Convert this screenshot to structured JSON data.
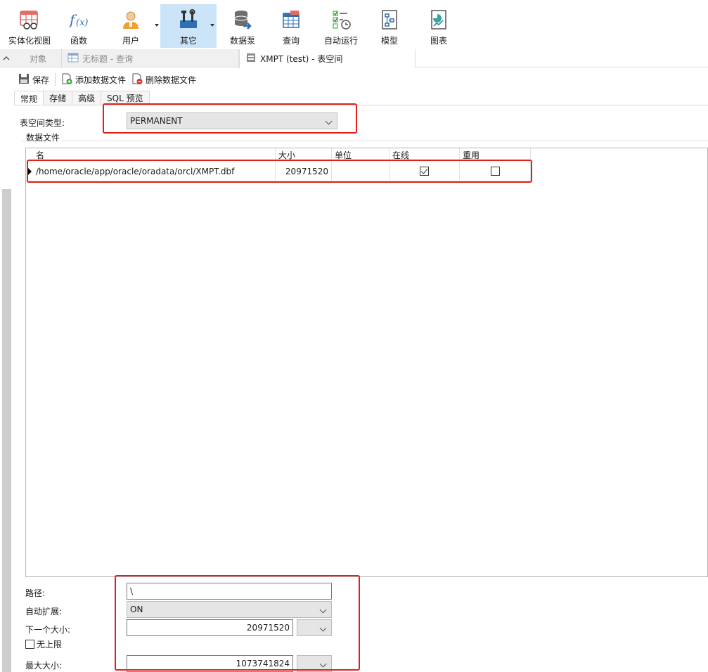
{
  "toolbar": {
    "buttons": [
      {
        "label": "实体化视图",
        "icon": "materialized-view-icon"
      },
      {
        "label": "函数",
        "icon": "function-icon"
      },
      {
        "label": "用户",
        "icon": "user-icon"
      },
      {
        "label": "其它",
        "icon": "tools-icon",
        "active": true
      },
      {
        "label": "数据泵",
        "icon": "data-pump-icon"
      },
      {
        "label": "查询",
        "icon": "query-icon"
      },
      {
        "label": "自动运行",
        "icon": "automation-icon"
      },
      {
        "label": "模型",
        "icon": "model-icon"
      },
      {
        "label": "图表",
        "icon": "chart-icon"
      }
    ]
  },
  "tabs": {
    "objects": "对象",
    "untitled_query": "无标题 - 查询",
    "active": "XMPT (test) - 表空间"
  },
  "subtoolbar": {
    "save": "保存",
    "add_datafile": "添加数据文件",
    "delete_datafile": "删除数据文件"
  },
  "property_tabs": [
    "常规",
    "存储",
    "高级",
    "SQL 预览"
  ],
  "form": {
    "tablespace_type_label": "表空间类型:",
    "tablespace_type_value": "PERMANENT",
    "datafiles_group": "数据文件"
  },
  "grid": {
    "columns": [
      "名",
      "大小",
      "单位",
      "在线",
      "重用"
    ],
    "rows": [
      {
        "name": "/home/oracle/app/oracle/oradata/orcl/XMPT.dbf",
        "size": "20971520",
        "unit": "",
        "online": true,
        "reuse": false
      }
    ]
  },
  "details": {
    "path_label": "路径:",
    "path_value": "\\",
    "autoextend_label": "自动扩展:",
    "autoextend_value": "ON",
    "next_size_label": "下一个大小:",
    "next_size_value": "20971520",
    "unlimited_label": "无上限",
    "max_size_label": "最大大小:",
    "max_size_value": "1073741824"
  },
  "colors": {
    "active_ribbon": "#cce4f7",
    "annotation_red": "#e0201b"
  }
}
